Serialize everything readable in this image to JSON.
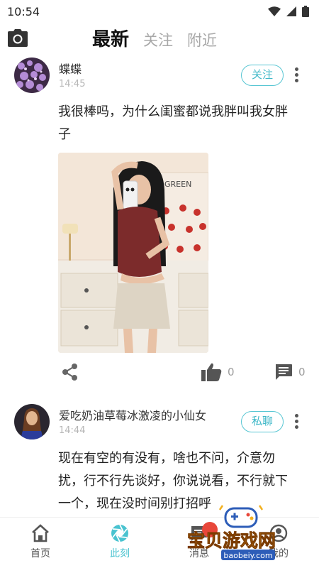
{
  "status_bar": {
    "time": "10:54"
  },
  "top_bar": {
    "tabs": [
      {
        "label": "最新",
        "active": true
      },
      {
        "label": "关注",
        "active": false
      },
      {
        "label": "附近",
        "active": false
      }
    ]
  },
  "posts": [
    {
      "username": "蝶蝶",
      "time": "14:45",
      "action_label": "关注",
      "text": "我很棒吗，为什么闺蜜都说我胖叫我女胖子",
      "likes": "0",
      "comments": "0"
    },
    {
      "username": "爱吃奶油草莓冰激凌的小仙女",
      "time": "14:44",
      "action_label": "私聊",
      "text": "现在有空的有没有，啥也不问，介意勿扰，行不行先谈好，你说说看，不行就下一个，现在没时间别打招呼"
    }
  ],
  "bottom_nav": {
    "items": [
      {
        "label": "首页",
        "icon": "home-icon"
      },
      {
        "label": "此刻",
        "icon": "camera-aperture-icon",
        "active": true
      },
      {
        "label": "消息",
        "icon": "message-icon"
      },
      {
        "label": "我的",
        "icon": "profile-icon"
      }
    ]
  },
  "watermark": {
    "text": "宝贝游戏网",
    "url": "baobeiy.com"
  },
  "colors": {
    "accent": "#49c3d0",
    "text": "#222222",
    "muted": "#b6b6b6"
  }
}
